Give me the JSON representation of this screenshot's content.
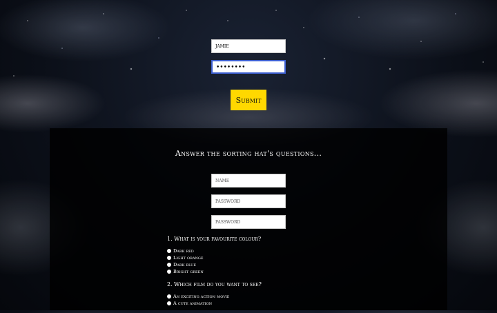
{
  "login": {
    "username_value": "jamie",
    "password_value": "••••••••"
  },
  "submit_label": "Submit",
  "panel": {
    "title": "Answer the sorting hat's questions...",
    "name_placeholder": "name",
    "password_placeholder": "password",
    "password_confirm_placeholder": "password"
  },
  "questions": [
    {
      "text": "1. What is your favourite colour?",
      "options": [
        "Dark red",
        "Light orange",
        "Dark blue",
        "Bright green"
      ]
    },
    {
      "text": "2. Which film do you want to see?",
      "options": [
        "An exciting action movie",
        "A cute animation"
      ]
    }
  ]
}
